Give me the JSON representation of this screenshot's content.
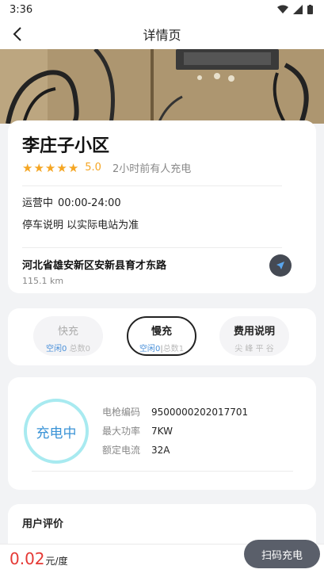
{
  "status_bar": {
    "time": "3:36"
  },
  "nav": {
    "title": "详情页"
  },
  "station": {
    "name": "李庄子小区",
    "rating": "5.0",
    "stars": 5,
    "last_charge": "2小时前有人充电",
    "status": "运营中",
    "hours": "00:00-24:00",
    "parking": "停车说明 以实际电站为准",
    "address": "河北省雄安新区安新县育才东路",
    "distance": "115.1 km"
  },
  "tabs": [
    {
      "label": "快充",
      "free_label": "空闲",
      "free": "0",
      "total_label": "总数",
      "total": "0",
      "active": false
    },
    {
      "label": "慢充",
      "free_label": "空闲",
      "free": "0",
      "total_label": "总数",
      "total": "1",
      "active": true
    },
    {
      "label": "费用说明",
      "sub": "尖 峰 平 谷",
      "active": false
    }
  ],
  "gun": {
    "status": "充电中",
    "specs": [
      {
        "label": "电枪编码",
        "value": "9500000202017701"
      },
      {
        "label": "最大功率",
        "value": "7KW"
      },
      {
        "label": "额定电流",
        "value": "32A"
      }
    ]
  },
  "reviews": {
    "title": "用户评价"
  },
  "bottom": {
    "price": "0.02",
    "unit": "元/度",
    "scan_label": "扫码充电"
  },
  "colors": {
    "accent_blue": "#3a93d6",
    "price_red": "#e53935",
    "star": "#f5a623",
    "button_dark": "#5a5f6a"
  },
  "icons": [
    "back-arrow-icon",
    "wifi-icon",
    "signal-icon",
    "battery-icon",
    "navigate-icon",
    "star-icon"
  ]
}
